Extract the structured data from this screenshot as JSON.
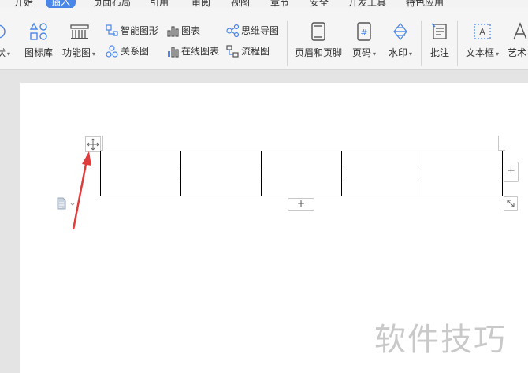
{
  "tabs": [
    {
      "label": "开始"
    },
    {
      "label": "插入"
    },
    {
      "label": "页面布局"
    },
    {
      "label": "引用"
    },
    {
      "label": "审阅"
    },
    {
      "label": "视图"
    },
    {
      "label": "章节"
    },
    {
      "label": "安全"
    },
    {
      "label": "开发工具"
    },
    {
      "label": "特色应用"
    }
  ],
  "ribbon": {
    "shape_partial": "状",
    "icon_lib": "图标库",
    "func_chart": "功能图",
    "smart_graphic": "智能图形",
    "relation_chart": "关系图",
    "chart": "图表",
    "online_chart": "在线图表",
    "mind_map": "思维导图",
    "flow_chart": "流程图",
    "header_footer": "页眉和页脚",
    "page_number": "页码",
    "watermark": "水印",
    "comment": "批注",
    "text_box": "文本框",
    "art_text_partial": "艺术"
  },
  "table": {
    "rows": 3,
    "cols": 5
  },
  "controls": {
    "add_col": "+",
    "add_row": "+"
  },
  "watermark_text": "软件技巧",
  "colors": {
    "accent": "#4a86e8",
    "arrow": "#e03c3c"
  }
}
